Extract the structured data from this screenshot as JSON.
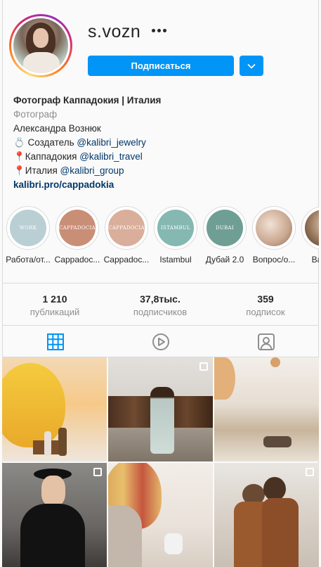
{
  "profile": {
    "username": "s.vozn",
    "follow_label": "Подписаться"
  },
  "bio": {
    "name": "Фотограф Каппадокия | Италия",
    "category": "Фотограф",
    "full_name": "Александра Вознюк",
    "line1_prefix": "💍 Создатель ",
    "line1_link": "@kalibri_jewelry",
    "line2_prefix": "📍Каппадокия ",
    "line2_link": "@kalibri_travel",
    "line3_prefix": "📍Италия ",
    "line3_link": "@kalibri_group",
    "website": "kalibri.pro/cappadokia"
  },
  "highlights": [
    {
      "label": "Работа/от...",
      "cover_text": "WORK",
      "color": "#b9cfd3"
    },
    {
      "label": "Cappadoc...",
      "cover_text": "CAPPADOCIA",
      "color": "#c98e76"
    },
    {
      "label": "Cappadoc...",
      "cover_text": "CAPPADOCIA",
      "color": "#d9ae9a"
    },
    {
      "label": "Istambul",
      "cover_text": "ISTAMBUL",
      "color": "#84b8b1"
    },
    {
      "label": "Дубай 2.0",
      "cover_text": "DUBAI",
      "color": "#6f9e94"
    },
    {
      "label": "Вопрос/о...",
      "cover_text": "",
      "color": "#d8c2b2"
    },
    {
      "label": "Backs",
      "cover_text": "",
      "color": "#9a7a5e"
    }
  ],
  "stats": [
    {
      "value": "1 210",
      "label": "публикаций"
    },
    {
      "value": "37,8тыс.",
      "label": "подписчиков"
    },
    {
      "value": "359",
      "label": "подписок"
    }
  ],
  "tabs": [
    "grid-icon",
    "reels-icon",
    "tagged-icon"
  ],
  "colors": {
    "accent": "#0095f6",
    "active_tab": "#0095f6",
    "muted": "#8e8e8e",
    "link": "#00376b"
  }
}
